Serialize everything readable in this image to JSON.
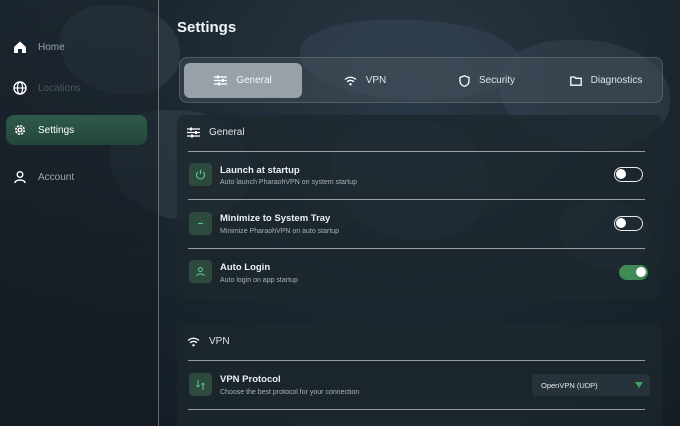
{
  "sidebar": {
    "items": [
      {
        "label": "Home",
        "icon": "home-icon"
      },
      {
        "label": "Locations",
        "icon": "globe-icon"
      },
      {
        "label": "Settings",
        "icon": "gear-icon"
      },
      {
        "label": "Account",
        "icon": "user-icon"
      }
    ],
    "active": "Settings"
  },
  "page": {
    "title": "Settings"
  },
  "tabs": [
    {
      "label": "General",
      "icon": "sliders-icon"
    },
    {
      "label": "VPN",
      "icon": "wifi-icon"
    },
    {
      "label": "Security",
      "icon": "shield-icon"
    },
    {
      "label": "Diagnostics",
      "icon": "folder-icon"
    }
  ],
  "general": {
    "heading": "General",
    "rows": [
      {
        "title": "Launch at startup",
        "desc": "Auto launch PharaohVPN on system startup",
        "icon": "power-icon",
        "enabled": false
      },
      {
        "title": "Minimize to System Tray",
        "desc": "Minimize PharaohVPN on auto startup",
        "icon": "minimize-icon",
        "enabled": false
      },
      {
        "title": "Auto Login",
        "desc": "Auto login on app startup",
        "icon": "user-icon",
        "enabled": true
      }
    ]
  },
  "vpn": {
    "heading": "VPN",
    "protocol": {
      "title": "VPN Protocol",
      "desc": "Choose the best protocol for your connection",
      "icon": "protocol-icon",
      "value": "OpenVPN (UDP)"
    }
  },
  "colors": {
    "accent": "#3f8a55",
    "active_nav": "#2f5a49",
    "background": "#1b2630"
  }
}
